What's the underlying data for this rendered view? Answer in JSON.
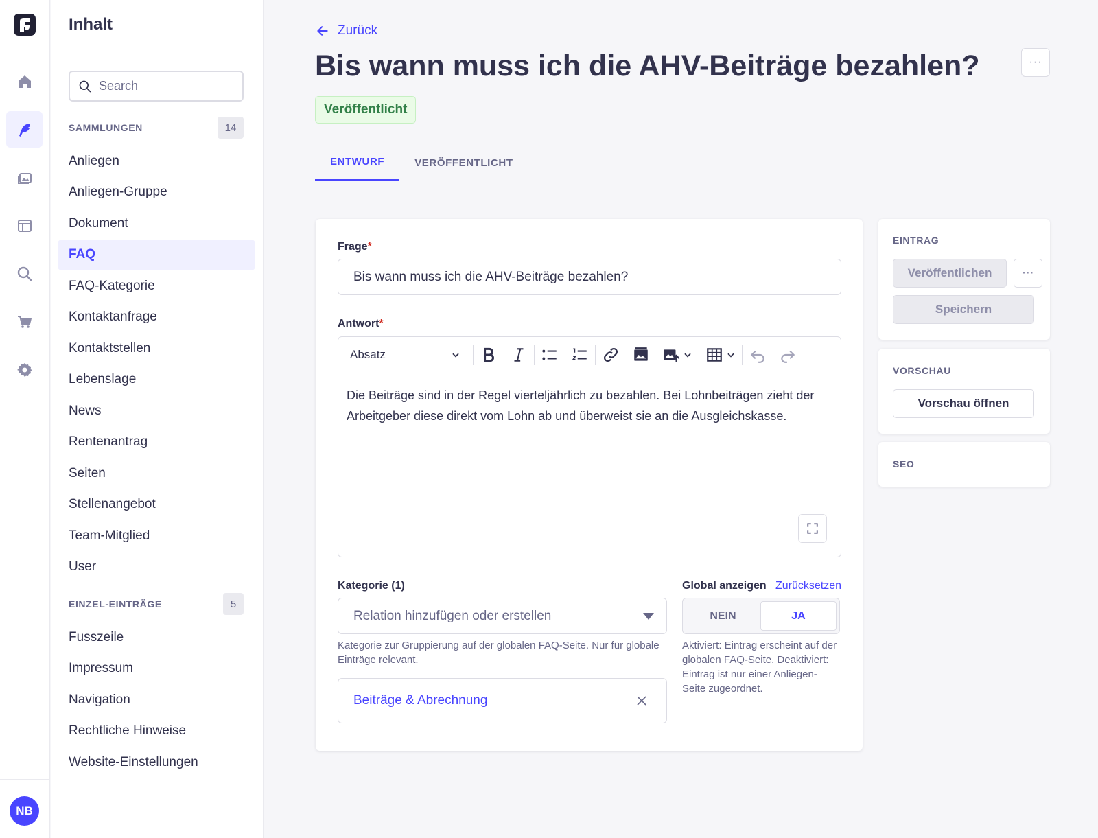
{
  "sidebar": {
    "title": "Inhalt",
    "search_placeholder": "Search",
    "collections_label": "SAMMLUNGEN",
    "collections_count": "14",
    "collections": [
      "Anliegen",
      "Anliegen-Gruppe",
      "Dokument",
      "FAQ",
      "FAQ-Kategorie",
      "Kontaktanfrage",
      "Kontaktstellen",
      "Lebenslage",
      "News",
      "Rentenantrag",
      "Seiten",
      "Stellenangebot",
      "Team-Mitglied",
      "User"
    ],
    "active_collection": "FAQ",
    "single_label": "EINZEL-EINTRÄGE",
    "single_count": "5",
    "singles": [
      "Fusszeile",
      "Impressum",
      "Navigation",
      "Rechtliche Hinweise",
      "Website-Einstellungen"
    ]
  },
  "user": {
    "initials": "NB"
  },
  "header": {
    "back_label": "Zurück",
    "title": "Bis wann muss ich die AHV-Beiträge bezahlen?",
    "status": "Veröffentlicht",
    "more": "···"
  },
  "tabs": [
    {
      "label": "ENTWURF",
      "active": true
    },
    {
      "label": "VERÖFFENTLICHT",
      "active": false
    }
  ],
  "form": {
    "question_label": "Frage",
    "question_value": "Bis wann muss ich die AHV-Beiträge bezahlen?",
    "answer_label": "Antwort",
    "paragraph_style": "Absatz",
    "answer_text": "Die Beiträge sind in der Regel vierteljährlich zu bezahlen. Bei Lohnbeiträgen zieht der Arbeitgeber diese direkt vom Lohn ab und überweist sie an die Ausgleichskasse.",
    "category_label": "Kategorie (1)",
    "category_placeholder": "Relation hinzufügen oder erstellen",
    "category_hint": "Kategorie zur Gruppierung auf der globalen FAQ-Seite. Nur für globale Einträge relevant.",
    "category_item": "Beiträge & Abrechnung",
    "global_label": "Global anzeigen",
    "reset_label": "Zurücksetzen",
    "toggle_no": "NEIN",
    "toggle_yes": "JA",
    "global_value": "JA",
    "global_hint": "Aktiviert: Eintrag erscheint auf der globalen FAQ-Seite. Deaktiviert: Eintrag ist nur einer Anliegen-Seite zugeordnet."
  },
  "panel": {
    "entry_heading": "EINTRAG",
    "publish_label": "Veröffentlichen",
    "more": "···",
    "save_label": "Speichern",
    "preview_heading": "VORSCHAU",
    "preview_label": "Vorschau öffnen",
    "seo_heading": "SEO"
  },
  "colors": {
    "primary": "#4945ff",
    "success_bg": "#eafbe7",
    "success_text": "#328048",
    "required": "#d02b20"
  }
}
